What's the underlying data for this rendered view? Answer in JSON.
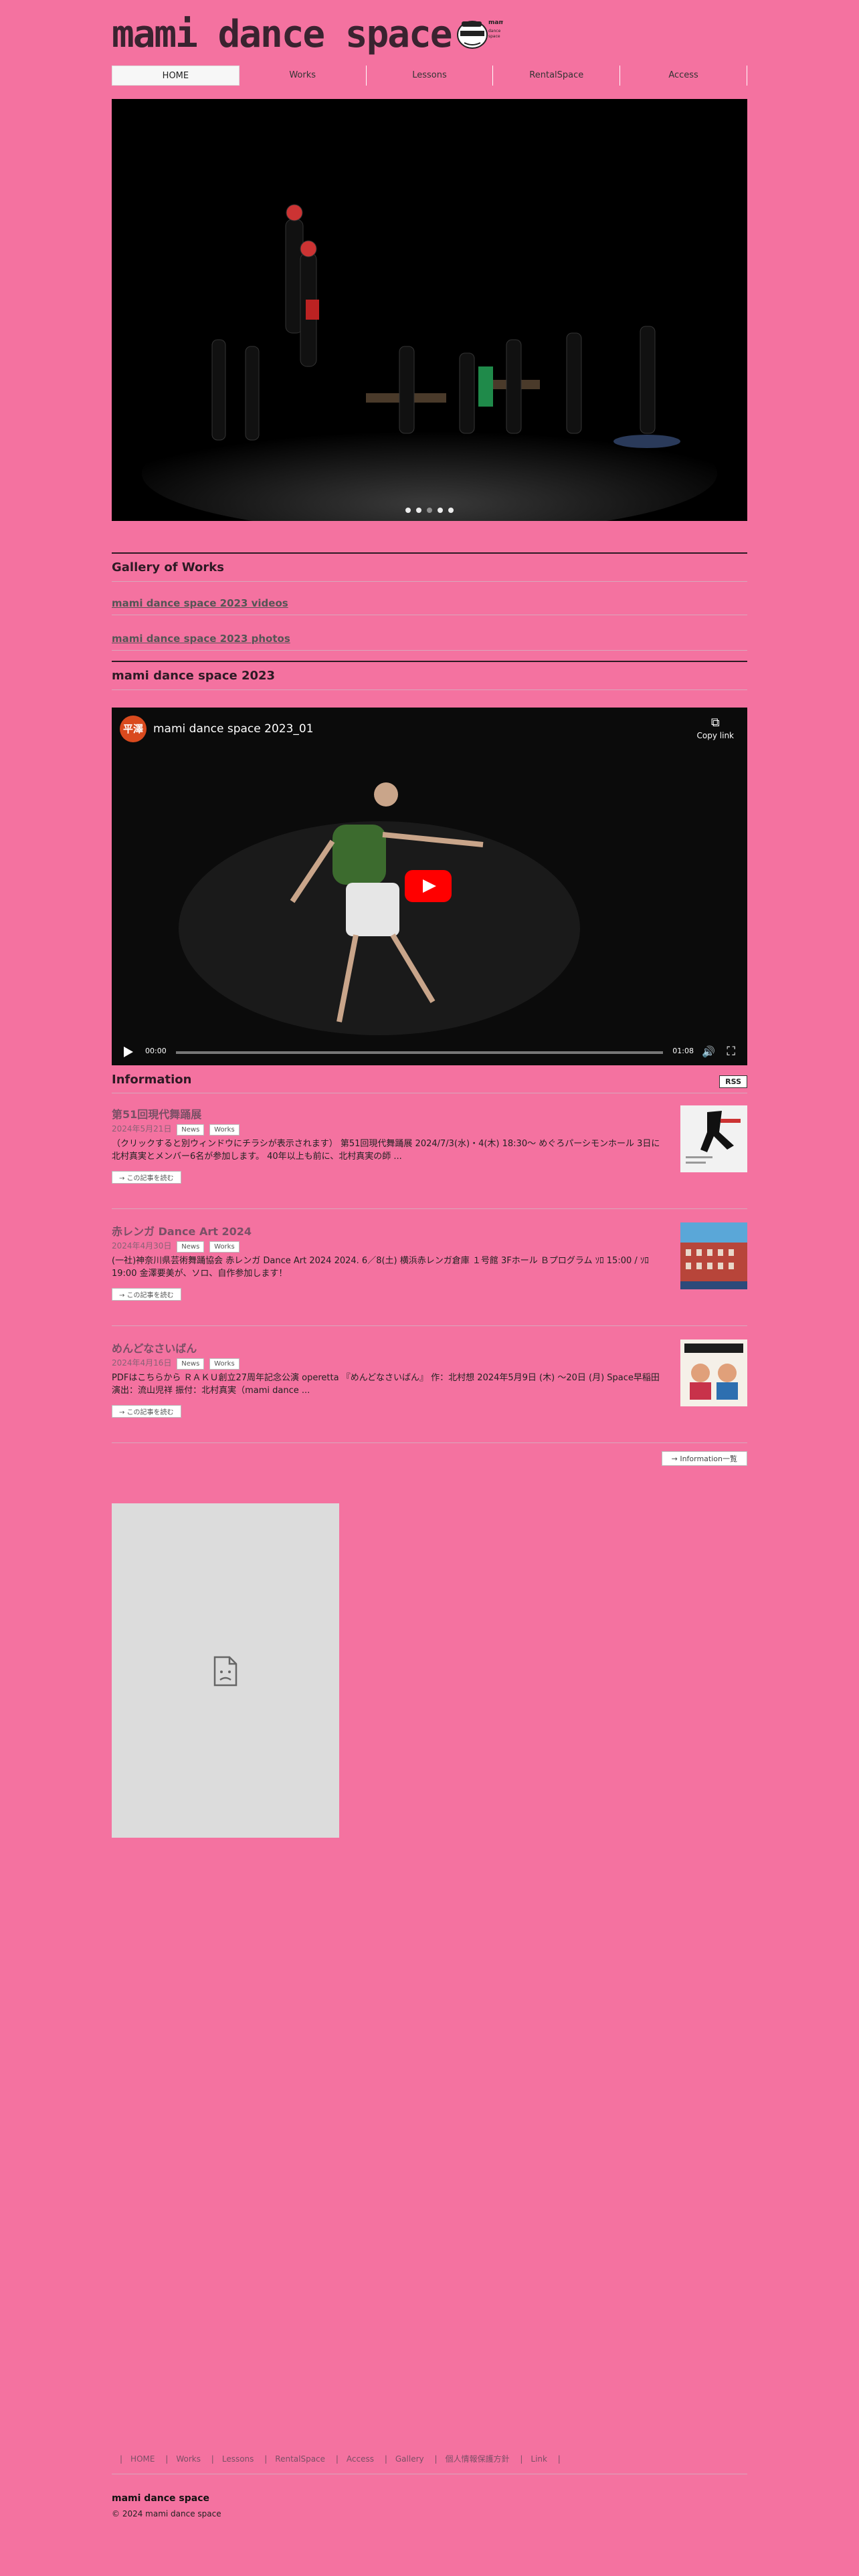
{
  "header": {
    "logo_text": "mami dance space",
    "logo_mark_text": "mami dance space"
  },
  "nav": {
    "items": [
      {
        "label": "HOME"
      },
      {
        "label": "Works"
      },
      {
        "label": "Lessons"
      },
      {
        "label": "RentalSpace"
      },
      {
        "label": "Access"
      }
    ]
  },
  "gallery": {
    "heading": "Gallery of Works",
    "videos_link": "mami dance space 2023 videos",
    "photos_link": "mami dance space 2023 photos"
  },
  "section2023": {
    "heading": "mami dance space 2023"
  },
  "video": {
    "avatar_text": "平澤",
    "title": "mami dance space 2023_01",
    "copy_label": "Copy link",
    "current_time": "00:00",
    "duration": "01:08"
  },
  "information": {
    "heading": "Information",
    "rss_label": "RSS",
    "posts": [
      {
        "title": "第51回現代舞踊展",
        "date": "2024年5月21日",
        "tags": [
          "News",
          "Works"
        ],
        "excerpt": "（クリックすると別ウィンドウにチラシが表示されます） 第51回現代舞踊展 2024/7/3(水)・4(木) 18:30〜 めぐろパーシモンホール 3日に北村真実とメンバー6名が参加します。 40年以上も前に、北村真実の師 ...",
        "more_label": "→ この記事を読む"
      },
      {
        "title": "赤レンガ Dance Art 2024",
        "date": "2024年4月30日",
        "tags": [
          "News",
          "Works"
        ],
        "excerpt": "(一社)神奈川県芸術舞踊協会 赤レンガ Dance Art 2024 2024. 6／8(土) 横浜赤レンガ倉庫 １号館 3Fホール Ｂプログラム ｿﾛ 15:00 / ｿﾛ19:00 金澤要美が、ソロ、自作参加します！",
        "more_label": "→ この記事を読む"
      },
      {
        "title": "めんどなさいばん",
        "date": "2024年4月16日",
        "tags": [
          "News",
          "Works"
        ],
        "excerpt": "PDFはこちらから ＲＡＫＵ創立27周年記念公演 operetta 『めんどなさいばん』 作：北村想 2024年5月9日 (木) 〜20日 (月) Space早稲田 演出：流山児祥 振付：北村真実（mami dance ...",
        "more_label": "→ この記事を読む"
      }
    ],
    "list_button": "→ Information一覧"
  },
  "footer": {
    "links": [
      "HOME",
      "Works",
      "Lessons",
      "RentalSpace",
      "Access",
      "Gallery",
      "個人情報保護方針",
      "Link"
    ],
    "site_name": "mami dance space",
    "copyright": "© 2024 mami dance space"
  },
  "colors": {
    "background": "#f472a0",
    "heading": "#2d1a24",
    "youtube_red": "#ff0000"
  }
}
